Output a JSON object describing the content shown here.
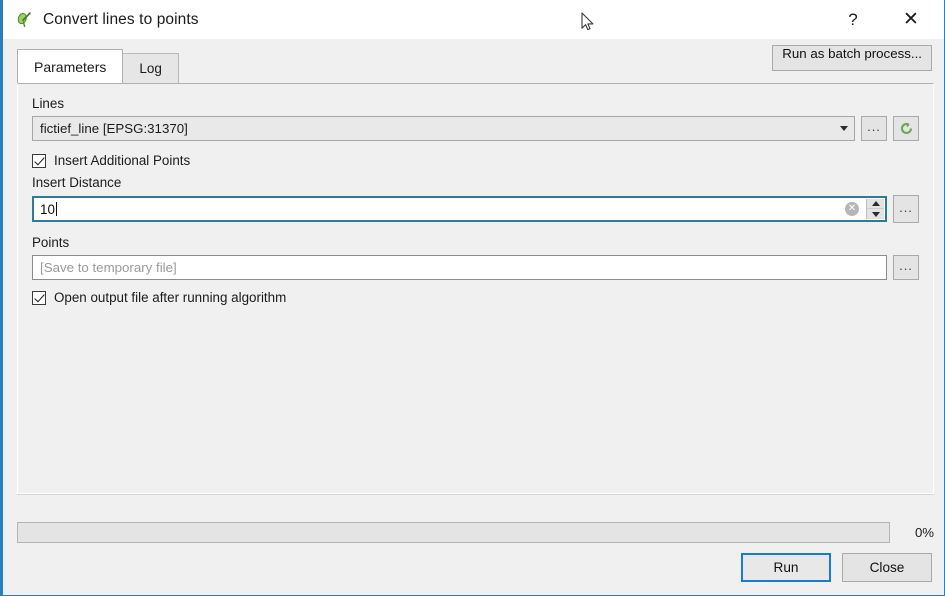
{
  "window": {
    "title": "Convert lines to points",
    "icon": "qgis-logo-icon",
    "help_label": "?",
    "close_label": "✕"
  },
  "tabs": [
    {
      "label": "Parameters",
      "active": true
    },
    {
      "label": "Log",
      "active": false
    }
  ],
  "toolbar": {
    "batch_label": "Run as batch process..."
  },
  "parameters": {
    "lines": {
      "label": "Lines",
      "value": "fictief_line [EPSG:31370]",
      "browse_label": "...",
      "iterate_icon": "iterate-features-icon"
    },
    "insert_additional_points": {
      "label": "Insert Additional Points",
      "checked": true
    },
    "insert_distance": {
      "label": "Insert Distance",
      "value": "10",
      "clear_label": "✕",
      "browse_label": "..."
    },
    "points": {
      "label": "Points",
      "value": "",
      "placeholder": "[Save to temporary file]",
      "browse_label": "..."
    },
    "open_output": {
      "label": "Open output file after running algorithm",
      "checked": true
    }
  },
  "progress": {
    "percent": 0,
    "percent_label": "0%"
  },
  "footer": {
    "run_label": "Run",
    "close_label": "Close"
  },
  "colors": {
    "window_border": "#2a7fba",
    "focus_border": "#2d7d96",
    "default_button_border": "#1b7bd0",
    "panel_background": "#f0f0f0",
    "titlebar_background": "#ffffff",
    "accent_green": "#6aa84f"
  }
}
